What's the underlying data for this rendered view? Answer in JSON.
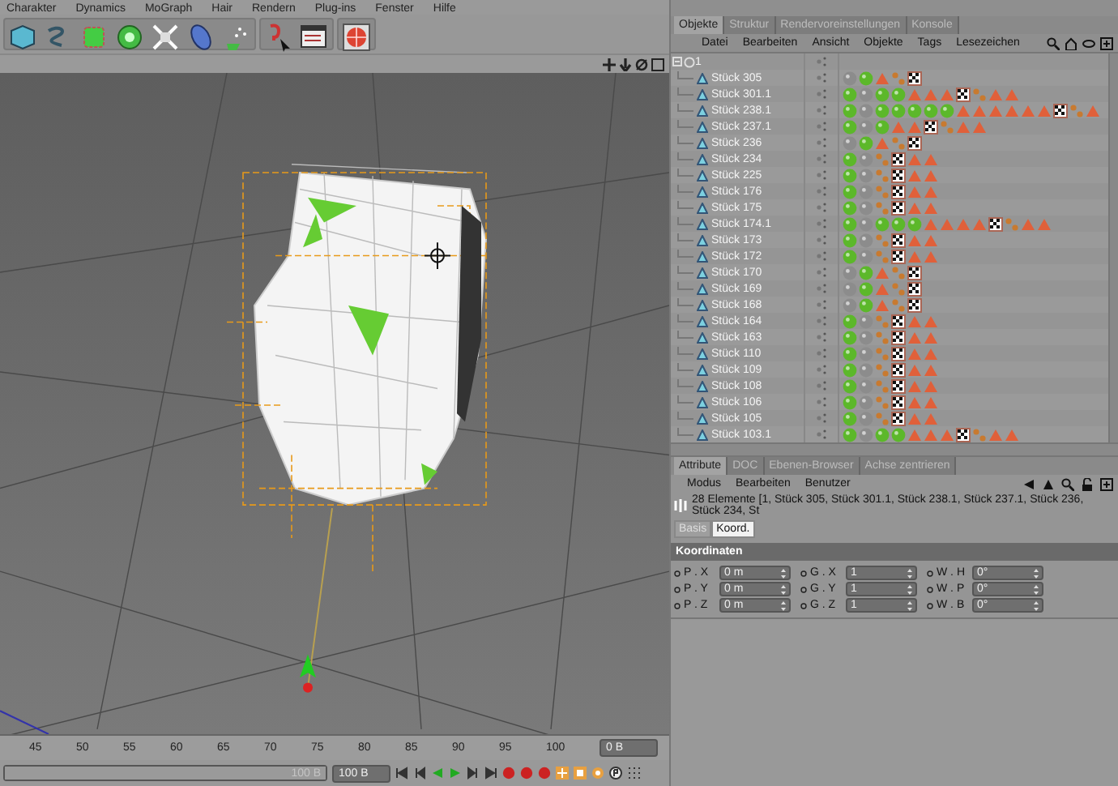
{
  "menu_bar": [
    "Charakter",
    "Dynamics",
    "MoGraph",
    "Hair",
    "Rendern",
    "Plug-ins",
    "Fenster",
    "Hilfe"
  ],
  "object_manager": {
    "tabs": [
      {
        "label": "Objekte",
        "selected": true
      },
      {
        "label": "Struktur",
        "selected": false
      },
      {
        "label": "Rendervoreinstellungen",
        "selected": false
      },
      {
        "label": "Konsole",
        "selected": false
      }
    ],
    "menu": [
      "Datei",
      "Bearbeiten",
      "Ansicht",
      "Objekte",
      "Tags",
      "Lesezeichen"
    ],
    "tree": {
      "label": "1",
      "expanded": true,
      "children": [
        {
          "label": "Stück 305",
          "tags": [
            {
              "kind": "sphere",
              "color": "#8c8c8c"
            },
            {
              "kind": "sphere",
              "color": "#5cb82a"
            },
            {
              "kind": "triangle"
            },
            {
              "kind": "chain"
            },
            {
              "kind": "checker"
            }
          ]
        },
        {
          "label": "Stück 301.1",
          "tags": [
            {
              "kind": "sphere",
              "color": "#5cb82a"
            },
            {
              "kind": "sphere",
              "color": "#8c8c8c"
            },
            {
              "kind": "sphere",
              "color": "#5cb82a"
            },
            {
              "kind": "sphere",
              "color": "#5cb82a"
            },
            {
              "kind": "triangle"
            },
            {
              "kind": "triangle"
            },
            {
              "kind": "triangle"
            },
            {
              "kind": "checker"
            },
            {
              "kind": "chain"
            },
            {
              "kind": "triangle"
            },
            {
              "kind": "triangle"
            }
          ]
        },
        {
          "label": "Stück 238.1",
          "tags": [
            {
              "kind": "sphere",
              "color": "#5cb82a"
            },
            {
              "kind": "sphere",
              "color": "#8c8c8c"
            },
            {
              "kind": "sphere",
              "color": "#5cb82a"
            },
            {
              "kind": "sphere",
              "color": "#5cb82a"
            },
            {
              "kind": "sphere",
              "color": "#5cb82a"
            },
            {
              "kind": "sphere",
              "color": "#5cb82a"
            },
            {
              "kind": "sphere",
              "color": "#5cb82a"
            },
            {
              "kind": "triangle"
            },
            {
              "kind": "triangle"
            },
            {
              "kind": "triangle"
            },
            {
              "kind": "triangle"
            },
            {
              "kind": "triangle"
            },
            {
              "kind": "triangle"
            },
            {
              "kind": "checker"
            },
            {
              "kind": "chain"
            },
            {
              "kind": "triangle"
            }
          ]
        },
        {
          "label": "Stück 237.1",
          "tags": [
            {
              "kind": "sphere",
              "color": "#5cb82a"
            },
            {
              "kind": "sphere",
              "color": "#8c8c8c"
            },
            {
              "kind": "sphere",
              "color": "#5cb82a"
            },
            {
              "kind": "triangle"
            },
            {
              "kind": "triangle"
            },
            {
              "kind": "checker"
            },
            {
              "kind": "chain"
            },
            {
              "kind": "triangle"
            },
            {
              "kind": "triangle"
            }
          ]
        },
        {
          "label": "Stück 236",
          "tags": [
            {
              "kind": "sphere",
              "color": "#8c8c8c"
            },
            {
              "kind": "sphere",
              "color": "#5cb82a"
            },
            {
              "kind": "triangle"
            },
            {
              "kind": "chain"
            },
            {
              "kind": "checker"
            }
          ]
        },
        {
          "label": "Stück 234",
          "tags": [
            {
              "kind": "sphere",
              "color": "#5cb82a"
            },
            {
              "kind": "sphere",
              "color": "#8c8c8c"
            },
            {
              "kind": "chain"
            },
            {
              "kind": "checker"
            },
            {
              "kind": "triangle"
            },
            {
              "kind": "triangle"
            }
          ]
        },
        {
          "label": "Stück 225",
          "tags": [
            {
              "kind": "sphere",
              "color": "#5cb82a"
            },
            {
              "kind": "sphere",
              "color": "#8c8c8c"
            },
            {
              "kind": "chain"
            },
            {
              "kind": "checker"
            },
            {
              "kind": "triangle"
            },
            {
              "kind": "triangle"
            }
          ]
        },
        {
          "label": "Stück 176",
          "tags": [
            {
              "kind": "sphere",
              "color": "#5cb82a"
            },
            {
              "kind": "sphere",
              "color": "#8c8c8c"
            },
            {
              "kind": "chain"
            },
            {
              "kind": "checker"
            },
            {
              "kind": "triangle"
            },
            {
              "kind": "triangle"
            }
          ]
        },
        {
          "label": "Stück 175",
          "tags": [
            {
              "kind": "sphere",
              "color": "#5cb82a"
            },
            {
              "kind": "sphere",
              "color": "#8c8c8c"
            },
            {
              "kind": "chain"
            },
            {
              "kind": "checker"
            },
            {
              "kind": "triangle"
            },
            {
              "kind": "triangle"
            }
          ]
        },
        {
          "label": "Stück 174.1",
          "tags": [
            {
              "kind": "sphere",
              "color": "#5cb82a"
            },
            {
              "kind": "sphere",
              "color": "#8c8c8c"
            },
            {
              "kind": "sphere",
              "color": "#5cb82a"
            },
            {
              "kind": "sphere",
              "color": "#5cb82a"
            },
            {
              "kind": "sphere",
              "color": "#5cb82a"
            },
            {
              "kind": "triangle"
            },
            {
              "kind": "triangle"
            },
            {
              "kind": "triangle"
            },
            {
              "kind": "triangle"
            },
            {
              "kind": "checker"
            },
            {
              "kind": "chain"
            },
            {
              "kind": "triangle"
            },
            {
              "kind": "triangle"
            }
          ]
        },
        {
          "label": "Stück 173",
          "tags": [
            {
              "kind": "sphere",
              "color": "#5cb82a"
            },
            {
              "kind": "sphere",
              "color": "#8c8c8c"
            },
            {
              "kind": "chain"
            },
            {
              "kind": "checker"
            },
            {
              "kind": "triangle"
            },
            {
              "kind": "triangle"
            }
          ]
        },
        {
          "label": "Stück 172",
          "tags": [
            {
              "kind": "sphere",
              "color": "#5cb82a"
            },
            {
              "kind": "sphere",
              "color": "#8c8c8c"
            },
            {
              "kind": "chain"
            },
            {
              "kind": "checker"
            },
            {
              "kind": "triangle"
            },
            {
              "kind": "triangle"
            }
          ]
        },
        {
          "label": "Stück 170",
          "tags": [
            {
              "kind": "sphere",
              "color": "#8c8c8c"
            },
            {
              "kind": "sphere",
              "color": "#5cb82a"
            },
            {
              "kind": "triangle"
            },
            {
              "kind": "chain"
            },
            {
              "kind": "checker"
            }
          ]
        },
        {
          "label": "Stück 169",
          "tags": [
            {
              "kind": "sphere",
              "color": "#8c8c8c"
            },
            {
              "kind": "sphere",
              "color": "#5cb82a"
            },
            {
              "kind": "triangle"
            },
            {
              "kind": "chain"
            },
            {
              "kind": "checker"
            }
          ]
        },
        {
          "label": "Stück 168",
          "tags": [
            {
              "kind": "sphere",
              "color": "#8c8c8c"
            },
            {
              "kind": "sphere",
              "color": "#5cb82a"
            },
            {
              "kind": "triangle"
            },
            {
              "kind": "chain"
            },
            {
              "kind": "checker"
            }
          ]
        },
        {
          "label": "Stück 164",
          "tags": [
            {
              "kind": "sphere",
              "color": "#5cb82a"
            },
            {
              "kind": "sphere",
              "color": "#8c8c8c"
            },
            {
              "kind": "chain"
            },
            {
              "kind": "checker"
            },
            {
              "kind": "triangle"
            },
            {
              "kind": "triangle"
            }
          ]
        },
        {
          "label": "Stück 163",
          "tags": [
            {
              "kind": "sphere",
              "color": "#5cb82a"
            },
            {
              "kind": "sphere",
              "color": "#8c8c8c"
            },
            {
              "kind": "chain"
            },
            {
              "kind": "checker"
            },
            {
              "kind": "triangle"
            },
            {
              "kind": "triangle"
            }
          ]
        },
        {
          "label": "Stück 110",
          "tags": [
            {
              "kind": "sphere",
              "color": "#5cb82a"
            },
            {
              "kind": "sphere",
              "color": "#8c8c8c"
            },
            {
              "kind": "chain"
            },
            {
              "kind": "checker"
            },
            {
              "kind": "triangle"
            },
            {
              "kind": "triangle"
            }
          ]
        },
        {
          "label": "Stück 109",
          "tags": [
            {
              "kind": "sphere",
              "color": "#5cb82a"
            },
            {
              "kind": "sphere",
              "color": "#8c8c8c"
            },
            {
              "kind": "chain"
            },
            {
              "kind": "checker"
            },
            {
              "kind": "triangle"
            },
            {
              "kind": "triangle"
            }
          ]
        },
        {
          "label": "Stück 108",
          "tags": [
            {
              "kind": "sphere",
              "color": "#5cb82a"
            },
            {
              "kind": "sphere",
              "color": "#8c8c8c"
            },
            {
              "kind": "chain"
            },
            {
              "kind": "checker"
            },
            {
              "kind": "triangle"
            },
            {
              "kind": "triangle"
            }
          ]
        },
        {
          "label": "Stück 106",
          "tags": [
            {
              "kind": "sphere",
              "color": "#5cb82a"
            },
            {
              "kind": "sphere",
              "color": "#8c8c8c"
            },
            {
              "kind": "chain"
            },
            {
              "kind": "checker"
            },
            {
              "kind": "triangle"
            },
            {
              "kind": "triangle"
            }
          ]
        },
        {
          "label": "Stück 105",
          "tags": [
            {
              "kind": "sphere",
              "color": "#5cb82a"
            },
            {
              "kind": "sphere",
              "color": "#8c8c8c"
            },
            {
              "kind": "chain"
            },
            {
              "kind": "checker"
            },
            {
              "kind": "triangle"
            },
            {
              "kind": "triangle"
            }
          ]
        },
        {
          "label": "Stück 103.1",
          "tags": [
            {
              "kind": "sphere",
              "color": "#5cb82a"
            },
            {
              "kind": "sphere",
              "color": "#8c8c8c"
            },
            {
              "kind": "sphere",
              "color": "#5cb82a"
            },
            {
              "kind": "sphere",
              "color": "#5cb82a"
            },
            {
              "kind": "triangle"
            },
            {
              "kind": "triangle"
            },
            {
              "kind": "triangle"
            },
            {
              "kind": "checker"
            },
            {
              "kind": "chain"
            },
            {
              "kind": "triangle"
            },
            {
              "kind": "triangle"
            }
          ]
        }
      ]
    }
  },
  "attributes": {
    "tabs": [
      {
        "label": "Attribute",
        "selected": true
      },
      {
        "label": "DOC",
        "selected": false
      },
      {
        "label": "Ebenen-Browser",
        "selected": false
      },
      {
        "label": "Achse zentrieren",
        "selected": false
      }
    ],
    "menu": [
      "Modus",
      "Bearbeiten",
      "Benutzer"
    ],
    "selection_info": "28 Elemente [1, Stück 305, Stück 301.1, Stück 238.1, Stück 237.1, Stück 236, Stück 234, St",
    "subtabs": [
      {
        "label": "Basis",
        "selected": false
      },
      {
        "label": "Koord.",
        "selected": true
      }
    ],
    "section": "Koordinaten",
    "fields": [
      {
        "label": "P . X",
        "value": "0 m"
      },
      {
        "label": "G . X",
        "value": "1"
      },
      {
        "label": "W . H",
        "value": "0°"
      },
      {
        "label": "P . Y",
        "value": "0 m"
      },
      {
        "label": "G . Y",
        "value": "1"
      },
      {
        "label": "W . P",
        "value": "0°"
      },
      {
        "label": "P . Z",
        "value": "0 m"
      },
      {
        "label": "G . Z",
        "value": "1"
      },
      {
        "label": "W . B",
        "value": "0°"
      }
    ]
  },
  "timeline": {
    "ruler": [
      "45",
      "50",
      "55",
      "60",
      "65",
      "70",
      "75",
      "80",
      "85",
      "90",
      "95",
      "100"
    ],
    "current_frame": "0 B",
    "slider": {
      "label": "100 B",
      "level": 1
    },
    "end_frame": "100 B"
  }
}
